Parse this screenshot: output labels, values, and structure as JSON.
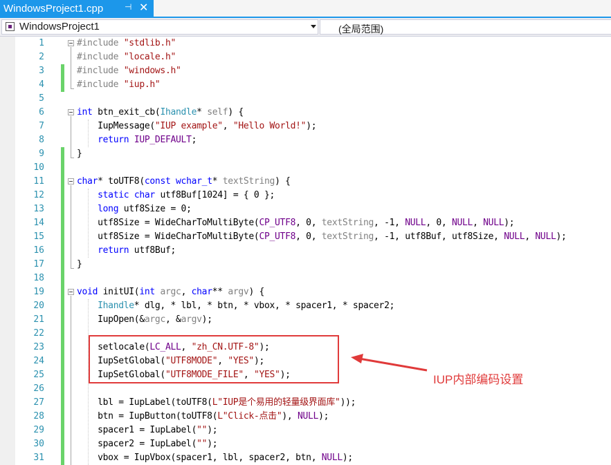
{
  "tab": {
    "title": "WindowsProject1.cpp",
    "pin_icon": "pin-icon",
    "close_icon": "close-icon"
  },
  "nav": {
    "project": "WindowsProject1",
    "scope": "(全局范围)"
  },
  "annotation": {
    "label": "IUP内部编码设置",
    "color": "#e03a3a"
  },
  "colors": {
    "accent": "#1c97ea",
    "keyword": "#0000ff",
    "type": "#2b91af",
    "string": "#a31515",
    "macro": "#6f008a",
    "changed": "#6ad36a"
  },
  "lines": [
    {
      "n": "1",
      "html": "<span class=\"pp\">#include </span><span class=\"st\">\"stdlib.h\"</span>"
    },
    {
      "n": "2",
      "html": "<span class=\"pp\">#include </span><span class=\"st\">\"locale.h\"</span>"
    },
    {
      "n": "3",
      "html": "<span class=\"pp\">#include </span><span class=\"st\">\"windows.h\"</span>"
    },
    {
      "n": "4",
      "html": "<span class=\"pp\">#include </span><span class=\"st\">\"iup.h\"</span>"
    },
    {
      "n": "5",
      "html": ""
    },
    {
      "n": "6",
      "html": "<span class=\"kw\">int</span> btn_exit_cb(<span class=\"ty\">Ihandle</span>* <span class=\"pa\">self</span>) {"
    },
    {
      "n": "7",
      "html": "    IupMessage(<span class=\"st\">\"IUP example\"</span>, <span class=\"st\">\"Hello World!\"</span>);"
    },
    {
      "n": "8",
      "html": "    <span class=\"kw\">return</span> <span class=\"mc\">IUP_DEFAULT</span>;"
    },
    {
      "n": "9",
      "html": "}"
    },
    {
      "n": "10",
      "html": ""
    },
    {
      "n": "11",
      "html": "<span class=\"kw\">char</span>* toUTF8(<span class=\"kw\">const</span> <span class=\"kw\">wchar_t</span>* <span class=\"pa\">textString</span>) {"
    },
    {
      "n": "12",
      "html": "    <span class=\"kw\">static</span> <span class=\"kw\">char</span> utf8Buf[1024] = { 0 };"
    },
    {
      "n": "13",
      "html": "    <span class=\"kw\">long</span> utf8Size = 0;"
    },
    {
      "n": "14",
      "html": "    utf8Size = WideCharToMultiByte(<span class=\"mc\">CP_UTF8</span>, 0, <span class=\"pa\">textString</span>, -1, <span class=\"mc\">NULL</span>, 0, <span class=\"mc\">NULL</span>, <span class=\"mc\">NULL</span>);"
    },
    {
      "n": "15",
      "html": "    utf8Size = WideCharToMultiByte(<span class=\"mc\">CP_UTF8</span>, 0, <span class=\"pa\">textString</span>, -1, utf8Buf, utf8Size, <span class=\"mc\">NULL</span>, <span class=\"mc\">NULL</span>);"
    },
    {
      "n": "16",
      "html": "    <span class=\"kw\">return</span> utf8Buf;"
    },
    {
      "n": "17",
      "html": "}"
    },
    {
      "n": "18",
      "html": ""
    },
    {
      "n": "19",
      "html": "<span class=\"kw\">void</span> initUI(<span class=\"kw\">int</span> <span class=\"pa\">argc</span>, <span class=\"kw\">char</span>** <span class=\"pa\">argv</span>) {"
    },
    {
      "n": "20",
      "html": "    <span class=\"ty\">Ihandle</span>* dlg, * lbl, * btn, * vbox, * spacer1, * spacer2;"
    },
    {
      "n": "21",
      "html": "    IupOpen(&amp;<span class=\"pa\">argc</span>, &amp;<span class=\"pa\">argv</span>);"
    },
    {
      "n": "22",
      "html": ""
    },
    {
      "n": "23",
      "html": "    setlocale(<span class=\"mc\">LC_ALL</span>, <span class=\"st\">\"zh_CN.UTF-8\"</span>);"
    },
    {
      "n": "24",
      "html": "    IupSetGlobal(<span class=\"st\">\"UTF8MODE\"</span>, <span class=\"st\">\"YES\"</span>);"
    },
    {
      "n": "25",
      "html": "    IupSetGlobal(<span class=\"st\">\"UTF8MODE_FILE\"</span>, <span class=\"st\">\"YES\"</span>);"
    },
    {
      "n": "26",
      "html": ""
    },
    {
      "n": "27",
      "html": "    lbl = IupLabel(toUTF8(<span class=\"st\">L\"IUP是个易用的轻量级界面库\"</span>));"
    },
    {
      "n": "28",
      "html": "    btn = IupButton(toUTF8(<span class=\"st\">L\"Click-点击\"</span>), <span class=\"mc\">NULL</span>);"
    },
    {
      "n": "29",
      "html": "    spacer1 = IupLabel(<span class=\"st\">\"\"</span>);"
    },
    {
      "n": "30",
      "html": "    spacer2 = IupLabel(<span class=\"st\">\"\"</span>);"
    },
    {
      "n": "31",
      "html": "    vbox = IupVbox(spacer1, lbl, spacer2, btn, <span class=\"mc\">NULL</span>);"
    }
  ]
}
